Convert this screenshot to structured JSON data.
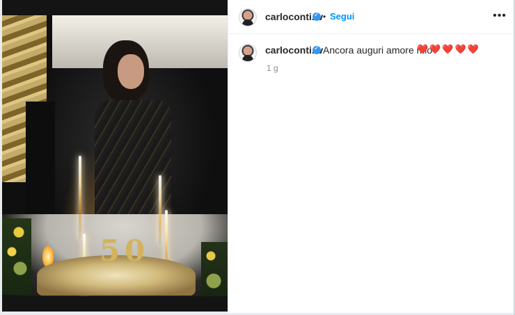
{
  "post": {
    "media_alt": "",
    "header": {
      "username": "carloconti.tv",
      "separator": "•",
      "follow_label": "Segui",
      "more_icon": "more-icon",
      "verified_icon": "verified-badge-icon"
    },
    "comment": {
      "username": "carloconti.tv",
      "text": "Ancora auguri amore mio",
      "hearts": "❤️❤️❤️❤️❤️",
      "time": "1 g",
      "verified_icon": "verified-badge-icon"
    },
    "accent_color": "#0095f6",
    "heart_color": "#e63a3a"
  }
}
